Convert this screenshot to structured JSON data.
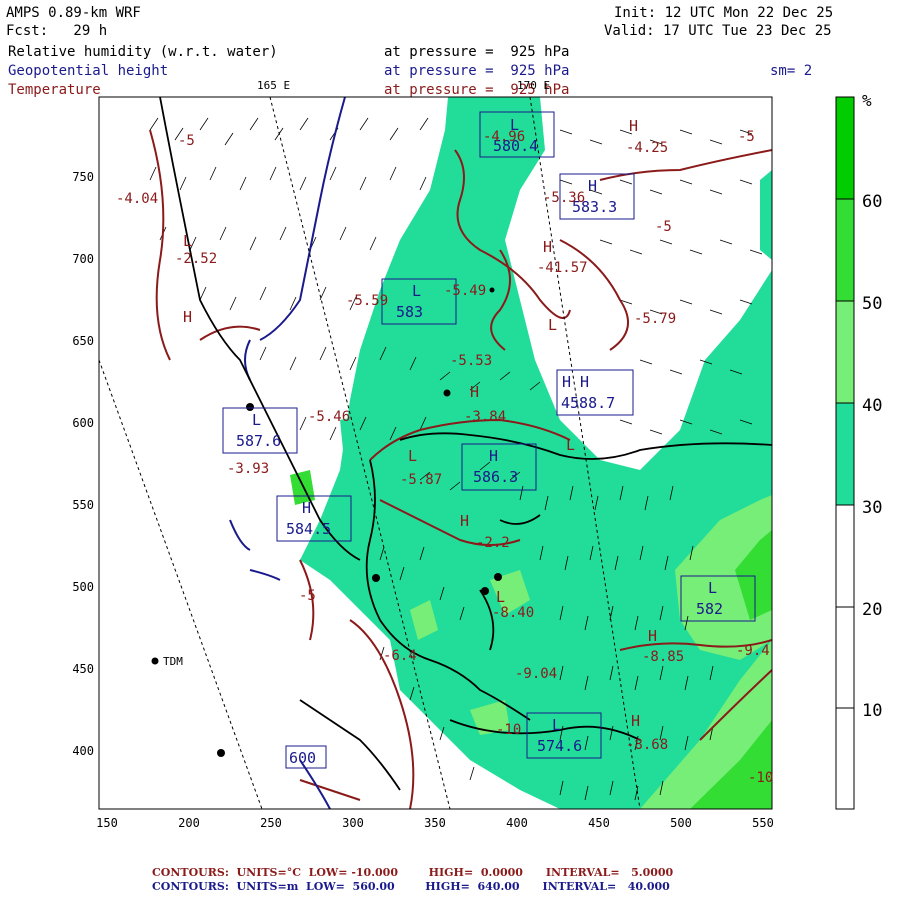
{
  "header": {
    "model": "AMPS 0.89-km WRF",
    "forecast": "Fcst:   29 h",
    "init": "Init: 12 UTC Mon 22 Dec 25",
    "valid": "Valid: 17 UTC Tue 23 Dec 25",
    "rh_label": "Relative humidity (w.r.t. water)",
    "gph_label": "Geopotential height",
    "temp_label": "Temperature",
    "pressure_1": "at pressure =  925 hPa",
    "pressure_2": "at pressure =  925 hPa",
    "pressure_3": "at pressure =  925 hPa",
    "smoothing": "sm= 2"
  },
  "map": {
    "x_ticks": [
      "150",
      "200",
      "250",
      "300",
      "350",
      "400",
      "450",
      "500",
      "550"
    ],
    "y_ticks": [
      "750",
      "700",
      "650",
      "600",
      "550",
      "500",
      "450",
      "400"
    ],
    "lon_labels": [
      "165 E",
      "170 E"
    ],
    "station": "TDM",
    "colors": {
      "rh_fill_30": "#22dd99",
      "rh_fill_40": "#77ee77",
      "rh_fill_50": "#33dd33",
      "temp_contour": "#8b1a1a",
      "height_contour": "#1a1a8c"
    },
    "height_boxes": [
      {
        "sym": "L",
        "val": "580.4"
      },
      {
        "sym": "H",
        "val": "583.3"
      },
      {
        "sym": "L",
        "val": "583"
      },
      {
        "sym": "H H",
        "val": "4588.7"
      },
      {
        "sym": "L",
        "val": "587.6"
      },
      {
        "sym": "H",
        "val": "586.3"
      },
      {
        "sym": "H",
        "val": "584.5"
      },
      {
        "sym": "L",
        "val": "582"
      },
      {
        "sym": "L",
        "val": "574.6"
      },
      {
        "sym": "",
        "val": "600"
      }
    ],
    "temp_labels": [
      "-4.96",
      "-4.25",
      "-5",
      "-4.04",
      "-5.36",
      "-5",
      "-2.52",
      "-41.57",
      "-5.59",
      "-5.49",
      "-5.79",
      "-5.53",
      "-3.84",
      "-5.46",
      "-3.93",
      "-5.87",
      "-2.2",
      "-5",
      "-6.4",
      "-8.40",
      "-9.04",
      "-8.85",
      "-9.4",
      "-8.68",
      "-10",
      "-10",
      "-5"
    ]
  },
  "colorbar": {
    "unit": "%",
    "ticks": [
      "60",
      "50",
      "40",
      "30",
      "20",
      "10"
    ],
    "colors": [
      "#00cc00",
      "#33dd33",
      "#77ee77",
      "#22dd99",
      "#ffffff",
      "#ffffff",
      "#ffffff"
    ]
  },
  "footer": {
    "temp_contours": "CONTOURS:  UNITS=°C  LOW= -10.000        HIGH=  0.0000      INTERVAL=   5.0000",
    "height_contours": "CONTOURS:  UNITS=m  LOW=  560.00        HIGH=  640.00      INTERVAL=   40.000"
  }
}
